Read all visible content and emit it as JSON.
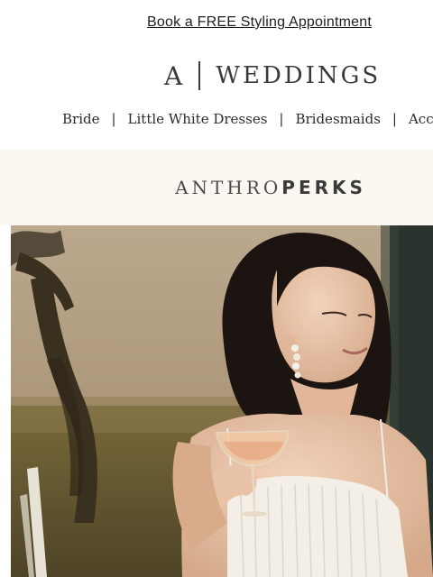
{
  "banner": {
    "link_text": "Book a FREE Styling Appointment"
  },
  "logo": {
    "mark": "A",
    "word": "WEDDINGS"
  },
  "nav": {
    "items": [
      {
        "label": "Bride"
      },
      {
        "label": "Little White Dresses"
      },
      {
        "label": "Bridesmaids"
      },
      {
        "label": "Acces"
      }
    ],
    "separator": "|"
  },
  "perks": {
    "part1": "ANTHRO",
    "part2": "PERKS"
  },
  "hero": {
    "image": "bride-holding-champagne-coupe-photo"
  },
  "colors": {
    "perks_background": "#fbf8f1",
    "text": "#2b2b2b"
  }
}
